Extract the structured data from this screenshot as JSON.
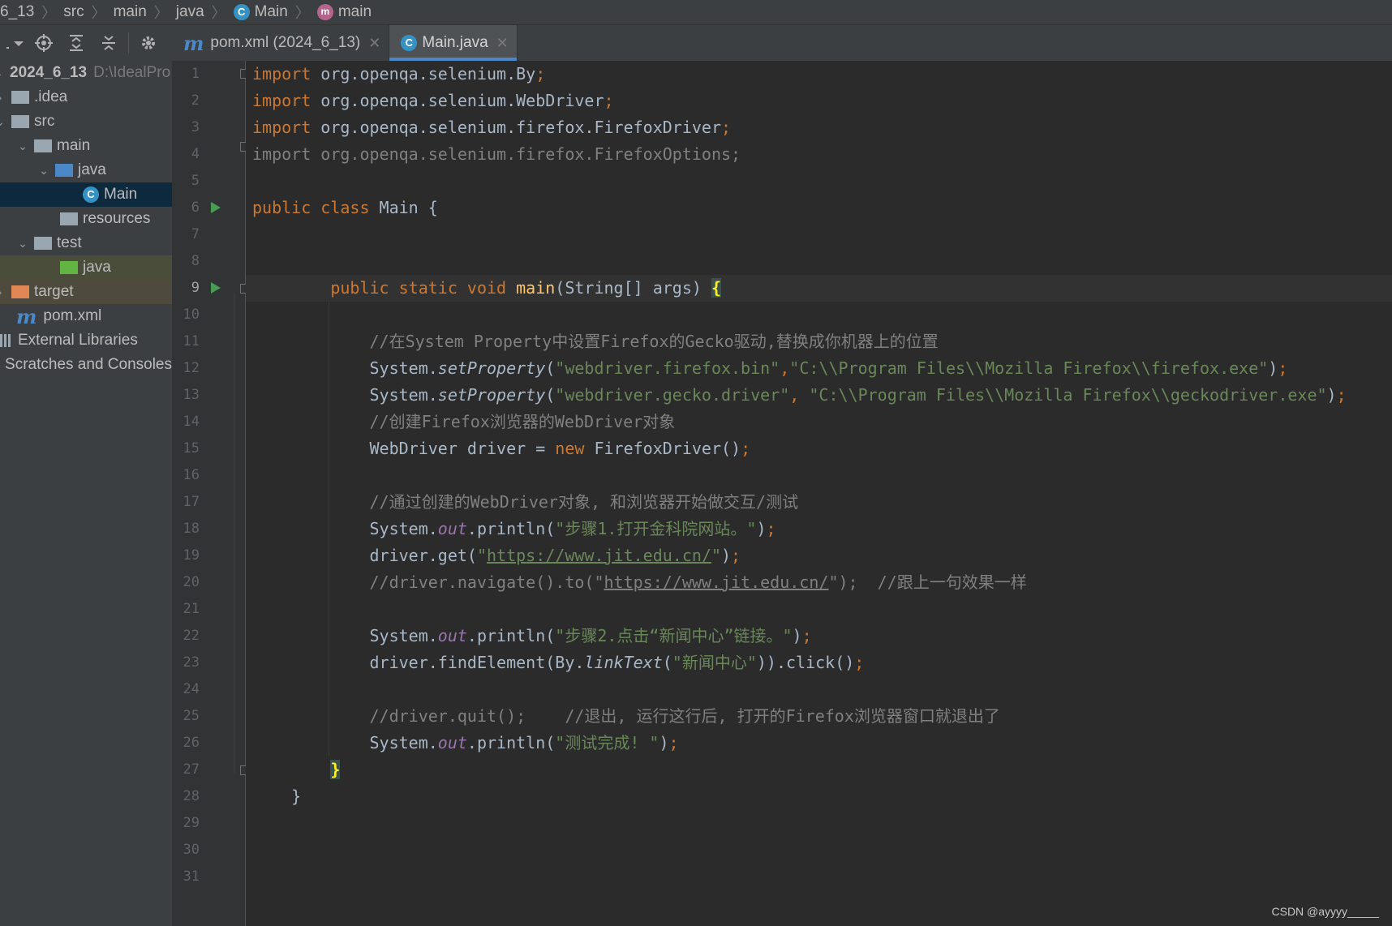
{
  "breadcrumb": {
    "items": [
      "6_13",
      "src",
      "main",
      "java",
      "Main",
      "main"
    ]
  },
  "tabs": [
    {
      "label": "pom.xml (2024_6_13)",
      "icon": "maven-icon",
      "active": false
    },
    {
      "label": "Main.java",
      "icon": "java-class-icon",
      "active": true
    }
  ],
  "project": {
    "root_name": "2024_6_13",
    "root_path": "D:\\IdealPro",
    "items": [
      {
        "label": ".idea",
        "icon": "folder-icon"
      },
      {
        "label": "src",
        "icon": "folder-icon"
      },
      {
        "label": "main",
        "icon": "folder-icon"
      },
      {
        "label": "java",
        "icon": "source-folder-icon"
      },
      {
        "label": "Main",
        "icon": "java-class-icon"
      },
      {
        "label": "resources",
        "icon": "resources-folder-icon"
      },
      {
        "label": "test",
        "icon": "folder-icon"
      },
      {
        "label": "java",
        "icon": "test-folder-icon"
      },
      {
        "label": "target",
        "icon": "excluded-folder-icon"
      },
      {
        "label": "pom.xml",
        "icon": "maven-icon"
      },
      {
        "label": "External Libraries",
        "icon": "library-icon"
      },
      {
        "label": "Scratches and Consoles",
        "icon": "scratches-icon"
      }
    ]
  },
  "editor": {
    "line_numbers": [
      "1",
      "2",
      "3",
      "4",
      "5",
      "6",
      "7",
      "8",
      "9",
      "10",
      "11",
      "12",
      "13",
      "14",
      "15",
      "16",
      "17",
      "18",
      "19",
      "20",
      "21",
      "22",
      "23",
      "24",
      "25",
      "26",
      "27",
      "28",
      "29",
      "30",
      "31"
    ],
    "current_line": 9,
    "code": {
      "imports": [
        "org.openqa.selenium.By",
        "org.openqa.selenium.WebDriver",
        "org.openqa.selenium.firefox.FirefoxDriver",
        "org.openqa.selenium.firefox.FirefoxOptions"
      ],
      "class_name": "Main",
      "comment1": "//在System Property中设置Firefox的Gecko驱动,替换成你机器上的位置",
      "prop1_key": "\"webdriver.firefox.bin\"",
      "prop1_val": "\"C:\\\\Program Files\\\\Mozilla Firefox\\\\firefox.exe\"",
      "prop2_key": "\"webdriver.gecko.driver\"",
      "prop2_val": "\"C:\\\\Program Files\\\\Mozilla Firefox\\\\geckodriver.exe\"",
      "comment2": "//创建Firefox浏览器的WebDriver对象",
      "comment3": "//通过创建的WebDriver对象, 和浏览器开始做交互/测试",
      "print1": "\"步骤1.打开金科院网站。\"",
      "url": "https://www.jit.edu.cn/",
      "comment4_prefix": "//driver.navigate().to(\"",
      "comment4_suffix": "\");",
      "comment4_tail": "//跟上一句效果一样",
      "print2": "\"步骤2.点击“新闻中心”链接。\"",
      "link_text": "\"新闻中心\"",
      "comment5a": "//driver.quit();",
      "comment5b": "//退出, 运行这行后, 打开的Firefox浏览器窗口就退出了",
      "print3": "\"测试完成! \""
    }
  },
  "watermark": "CSDN @ayyyy_____"
}
